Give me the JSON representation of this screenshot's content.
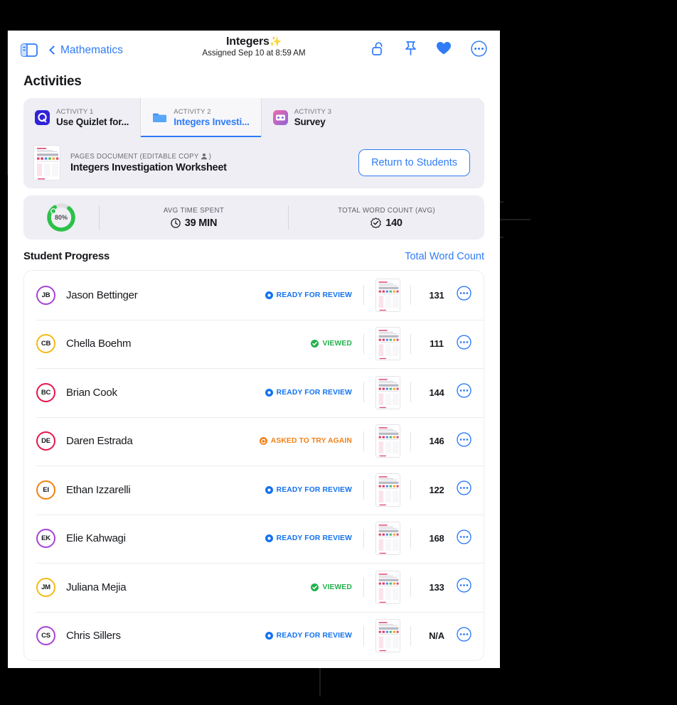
{
  "navbar": {
    "sidebar_icon": "sidebar-toggle-icon",
    "back_label": "Mathematics",
    "title": "Integers",
    "title_sparkle": "✨",
    "subtitle": "Assigned Sep 10 at 8:59 AM",
    "actions": [
      {
        "name": "unlock-icon",
        "label": "Unlock"
      },
      {
        "name": "pin-icon",
        "label": "Pin"
      },
      {
        "name": "heart-icon",
        "label": "Favorite"
      },
      {
        "name": "more-options-icon",
        "label": "More"
      }
    ],
    "accent_color": "#2f7cf6"
  },
  "page": {
    "section_title": "Activities"
  },
  "activities": {
    "tabs": [
      {
        "kicker": "ACTIVITY 1",
        "name": "Use Quizlet for...",
        "icon": "quizlet-icon",
        "active": false
      },
      {
        "kicker": "ACTIVITY 2",
        "name": "Integers Investi...",
        "icon": "folder-icon",
        "active": true
      },
      {
        "kicker": "ACTIVITY 3",
        "name": "Survey",
        "icon": "survey-icon",
        "active": false
      }
    ]
  },
  "document": {
    "kicker_prefix": "PAGES DOCUMENT (EDITABLE COPY",
    "kicker_suffix": ")",
    "person_icon": "person-icon",
    "title": "Integers Investigation Worksheet",
    "thumbnail_icon": "document-thumbnail",
    "return_button": "Return to Students"
  },
  "stats": {
    "progress_percent": "80%",
    "progress_value": 80,
    "progress_color": "#2cc14a",
    "items": [
      {
        "label": "AVG TIME SPENT",
        "value": "39 MIN",
        "icon": "clock-icon"
      },
      {
        "label": "TOTAL WORD COUNT (AVG)",
        "value": "140",
        "icon": "checkmark-seal-icon"
      }
    ]
  },
  "student_progress": {
    "title": "Student Progress",
    "link": "Total Word Count",
    "status_colors": {
      "ready": "#1272f0",
      "viewed": "#22b24c",
      "retry": "#f08016"
    },
    "rows": [
      {
        "initials": "JB",
        "ring": "#a742d6",
        "name": "Jason Bettinger",
        "status": "READY FOR REVIEW",
        "status_type": "ready",
        "count": "131"
      },
      {
        "initials": "CB",
        "ring": "#f5b916",
        "name": "Chella Boehm",
        "status": "VIEWED",
        "status_type": "viewed",
        "count": "111"
      },
      {
        "initials": "BC",
        "ring": "#e8134b",
        "name": "Brian Cook",
        "status": "READY FOR REVIEW",
        "status_type": "ready",
        "count": "144"
      },
      {
        "initials": "DE",
        "ring": "#e8134b",
        "name": "Daren Estrada",
        "status": "ASKED TO TRY AGAIN",
        "status_type": "retry",
        "count": "146"
      },
      {
        "initials": "EI",
        "ring": "#f2820c",
        "name": "Ethan Izzarelli",
        "status": "READY FOR REVIEW",
        "status_type": "ready",
        "count": "122"
      },
      {
        "initials": "EK",
        "ring": "#a742d6",
        "name": "Elie Kahwagi",
        "status": "READY FOR REVIEW",
        "status_type": "ready",
        "count": "168"
      },
      {
        "initials": "JM",
        "ring": "#f5b916",
        "name": "Juliana Mejia",
        "status": "VIEWED",
        "status_type": "viewed",
        "count": "133"
      },
      {
        "initials": "CS",
        "ring": "#a742d6",
        "name": "Chris Sillers",
        "status": "READY FOR REVIEW",
        "status_type": "ready",
        "count": "N/A"
      }
    ],
    "row_more_icon": "more-options-icon",
    "row_thumb_icon": "document-thumbnail"
  }
}
